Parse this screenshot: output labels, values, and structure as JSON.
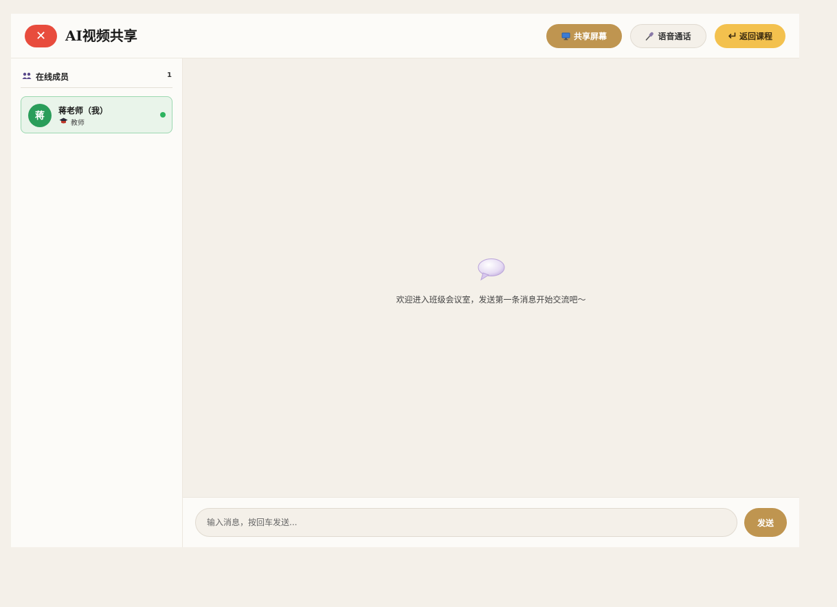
{
  "header": {
    "close_label": "✕",
    "title": "AI视频共享",
    "share_screen_label": "共享屏幕",
    "voice_call_label": "语音通话",
    "back_label": "返回课程"
  },
  "sidebar": {
    "heading": "在线成员",
    "count": "1",
    "members": [
      {
        "avatar_text": "蒋",
        "name": "蒋老师（我）",
        "role": "教师",
        "status_color": "#2db35f"
      }
    ]
  },
  "main": {
    "empty_message": "欢迎进入班级会议室，发送第一条消息开始交流吧～"
  },
  "composer": {
    "placeholder": "输入消息，按回车发送...",
    "value": "",
    "send_label": "发送"
  },
  "icons": {
    "share": "monitor-icon",
    "voice": "microphone-icon",
    "back": "return-arrow-icon",
    "members": "people-icon",
    "role": "graduation-cap-icon",
    "empty": "speech-bubble-icon"
  },
  "colors": {
    "close": "#e84c3d",
    "primary": "#bf9550",
    "back": "#f3c14e",
    "online": "#2db35f",
    "avatar": "#2a9d5a"
  }
}
